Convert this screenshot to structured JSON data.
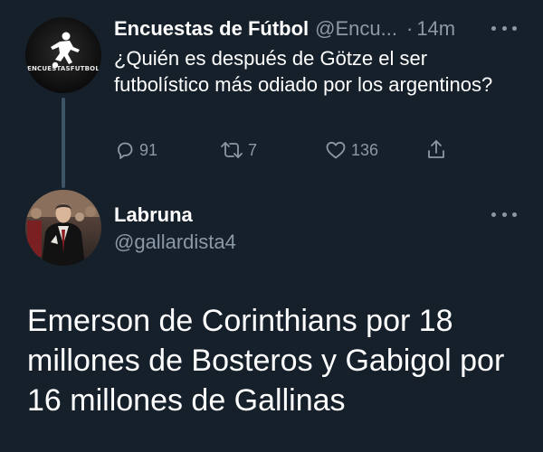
{
  "parent_tweet": {
    "avatar_icon": "soccer-player-logo-icon",
    "avatar_wordmark": "ENCUESTASFUTBOL",
    "display_name": "Encuestas de Fútbol",
    "handle": "@Encu...",
    "time_separator": "·",
    "time": "14m",
    "text": "¿Quién es después de Götze el ser futbolístico más odiado por los argentinos?",
    "actions": {
      "reply_icon": "reply-icon",
      "reply_count": "91",
      "retweet_icon": "retweet-icon",
      "retweet_count": "7",
      "like_icon": "heart-icon",
      "like_count": "136",
      "share_icon": "share-icon"
    }
  },
  "reply_tweet": {
    "display_name": "Labruna",
    "handle": "@gallardista4",
    "text": "Emerson de Corinthians por 18 millones de Bosteros y Gabigol por 16 millones de Gallinas"
  },
  "colors": {
    "background": "#15202b",
    "primary_text": "#ffffff",
    "secondary_text": "#8b98a5",
    "thread_line": "#3d5466"
  }
}
